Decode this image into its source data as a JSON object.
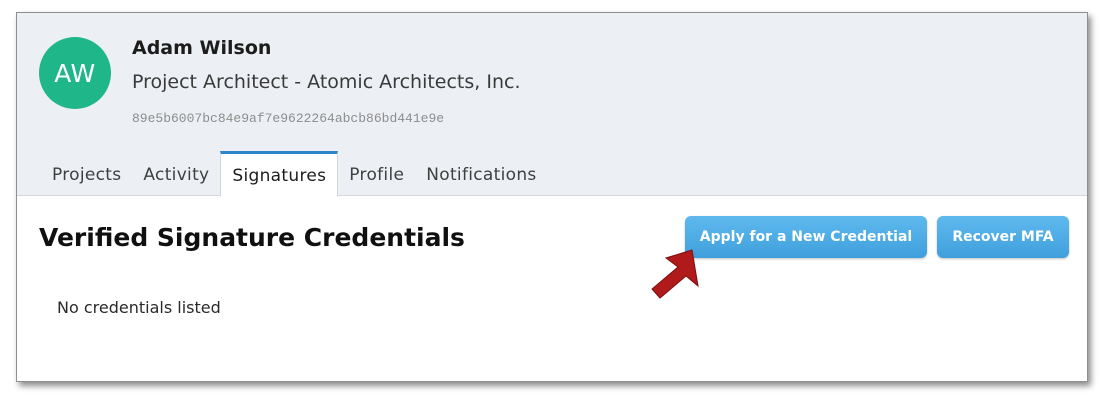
{
  "user": {
    "initials": "AW",
    "name": "Adam Wilson",
    "title": "Project Architect - Atomic Architects, Inc.",
    "id_hash": "89e5b6007bc84e9af7e9622264abcb86bd441e9e"
  },
  "tabs": [
    {
      "label": "Projects",
      "active": false
    },
    {
      "label": "Activity",
      "active": false
    },
    {
      "label": "Signatures",
      "active": true
    },
    {
      "label": "Profile",
      "active": false
    },
    {
      "label": "Notifications",
      "active": false
    }
  ],
  "section": {
    "title": "Verified Signature Credentials",
    "empty_message": "No credentials listed"
  },
  "buttons": {
    "apply_label": "Apply for a New Credential",
    "recover_label": "Recover MFA"
  },
  "colors": {
    "avatar": "#1fb68a",
    "accent": "#3f9fdc",
    "annotation_arrow": "#b01a1a"
  },
  "annotation": {
    "icon": "red-pointer-arrow-icon"
  }
}
